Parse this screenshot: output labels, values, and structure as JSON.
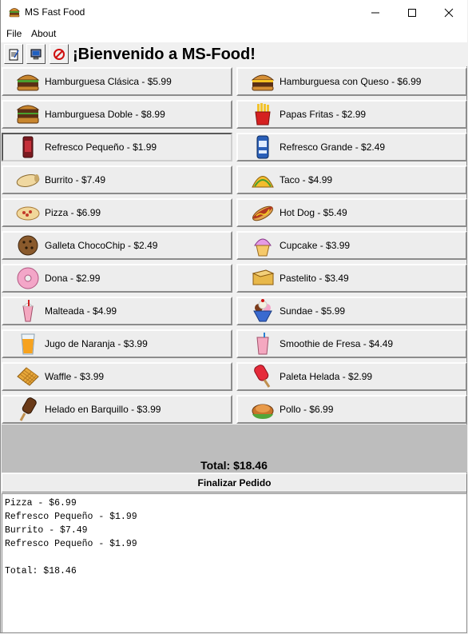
{
  "window": {
    "title": "MS Fast Food"
  },
  "menu": {
    "file": "File",
    "about": "About"
  },
  "toolbar": {
    "welcome": "¡Bienvenido a MS-Food!"
  },
  "items": [
    {
      "label": "Hamburguesa Clásica - $5.99",
      "icon": "burger-icon"
    },
    {
      "label": "Hamburguesa con Queso - $6.99",
      "icon": "cheeseburger-icon"
    },
    {
      "label": "Hamburguesa Doble - $8.99",
      "icon": "double-burger-icon"
    },
    {
      "label": "Papas Fritas - $2.99",
      "icon": "fries-icon"
    },
    {
      "label": "Refresco Pequeño - $1.99",
      "icon": "soda-small-icon"
    },
    {
      "label": "Refresco Grande - $2.49",
      "icon": "soda-large-icon"
    },
    {
      "label": "Burrito - $7.49",
      "icon": "burrito-icon"
    },
    {
      "label": "Taco - $4.99",
      "icon": "taco-icon"
    },
    {
      "label": "Pizza - $6.99",
      "icon": "pizza-icon"
    },
    {
      "label": "Hot Dog - $5.49",
      "icon": "hotdog-icon"
    },
    {
      "label": "Galleta ChocoChip - $2.49",
      "icon": "cookie-icon"
    },
    {
      "label": "Cupcake - $3.99",
      "icon": "cupcake-icon"
    },
    {
      "label": "Dona - $2.99",
      "icon": "donut-icon"
    },
    {
      "label": "Pastelito - $3.49",
      "icon": "cake-icon"
    },
    {
      "label": "Malteada - $4.99",
      "icon": "milkshake-icon"
    },
    {
      "label": "Sundae - $5.99",
      "icon": "sundae-icon"
    },
    {
      "label": "Jugo de Naranja - $3.99",
      "icon": "orange-juice-icon"
    },
    {
      "label": "Smoothie de Fresa - $4.49",
      "icon": "smoothie-icon"
    },
    {
      "label": "Waffle - $3.99",
      "icon": "waffle-icon"
    },
    {
      "label": "Paleta Helada - $2.99",
      "icon": "popsicle-icon"
    },
    {
      "label": "Helado en Barquillo - $3.99",
      "icon": "ice-cream-bar-icon"
    },
    {
      "label": "Pollo - $6.99",
      "icon": "chicken-icon"
    }
  ],
  "total": {
    "label": "Total: $18.46"
  },
  "finalize": {
    "label": "Finalizar Pedido"
  },
  "receipt": {
    "lines": [
      "Pizza - $6.99",
      "Refresco Pequeño - $1.99",
      "Burrito - $7.49",
      "Refresco Pequeño - $1.99",
      "",
      "Total: $18.46"
    ]
  }
}
